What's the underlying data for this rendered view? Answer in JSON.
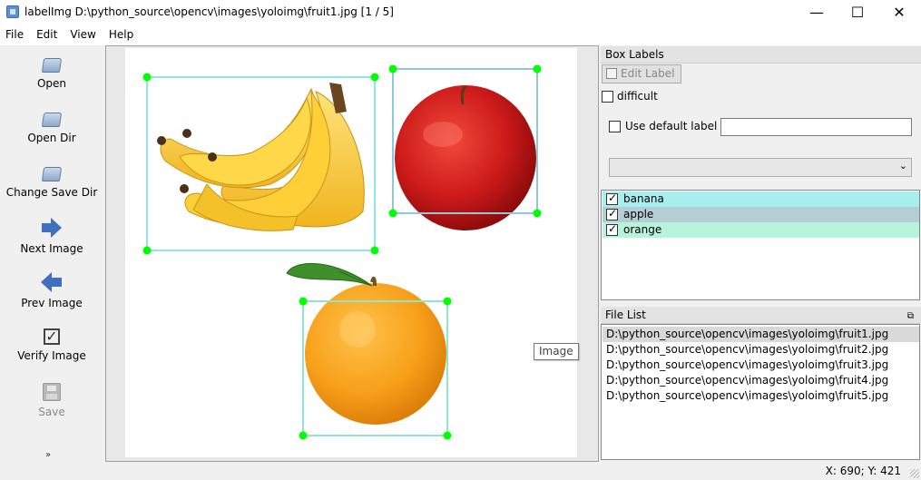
{
  "window": {
    "title": "labelImg D:\\python_source\\opencv\\images\\yoloimg\\fruit1.jpg [1 / 5]",
    "minimize": "—",
    "maximize": "☐",
    "close": "✕"
  },
  "menu": [
    "File",
    "Edit",
    "View",
    "Help"
  ],
  "toolbar": {
    "items": [
      {
        "label": "Open",
        "icon": "folder-open-icon"
      },
      {
        "label": "Open Dir",
        "icon": "folder-open-icon"
      },
      {
        "label": "Change Save Dir",
        "icon": "folder-open-icon"
      },
      {
        "label": "Next Image",
        "icon": "arrow-right-icon"
      },
      {
        "label": "Prev Image",
        "icon": "arrow-left-icon"
      },
      {
        "label": "Verify Image",
        "icon": "checkbox-icon"
      },
      {
        "label": "Save",
        "icon": "floppy-disk-icon",
        "disabled": true
      }
    ],
    "more": "»"
  },
  "canvas": {
    "tooltip": "Image",
    "boxes": [
      {
        "label": "banana",
        "color": "#8fe6e6"
      },
      {
        "label": "apple",
        "color": "#8fc8d8"
      },
      {
        "label": "orange",
        "color": "#8fe6c8"
      }
    ],
    "vertex_color": "#00ff00"
  },
  "box_labels": {
    "title": "Box Labels",
    "edit_label": "Edit Label",
    "difficult": "difficult",
    "use_default_label": "Use default label",
    "default_label_value": "",
    "dropdown_value": "",
    "labels": [
      {
        "name": "banana",
        "checked": true,
        "bg": "#a6efee"
      },
      {
        "name": "apple",
        "checked": true,
        "bg": "#b5cdd4"
      },
      {
        "name": "orange",
        "checked": true,
        "bg": "#b8f3dc"
      }
    ]
  },
  "file_list": {
    "title": "File List",
    "files": [
      "D:\\python_source\\opencv\\images\\yoloimg\\fruit1.jpg",
      "D:\\python_source\\opencv\\images\\yoloimg\\fruit2.jpg",
      "D:\\python_source\\opencv\\images\\yoloimg\\fruit3.jpg",
      "D:\\python_source\\opencv\\images\\yoloimg\\fruit4.jpg",
      "D:\\python_source\\opencv\\images\\yoloimg\\fruit5.jpg"
    ],
    "selected_index": 0,
    "float_icon": "⧉"
  },
  "status": {
    "coords": "X: 690; Y: 421"
  }
}
